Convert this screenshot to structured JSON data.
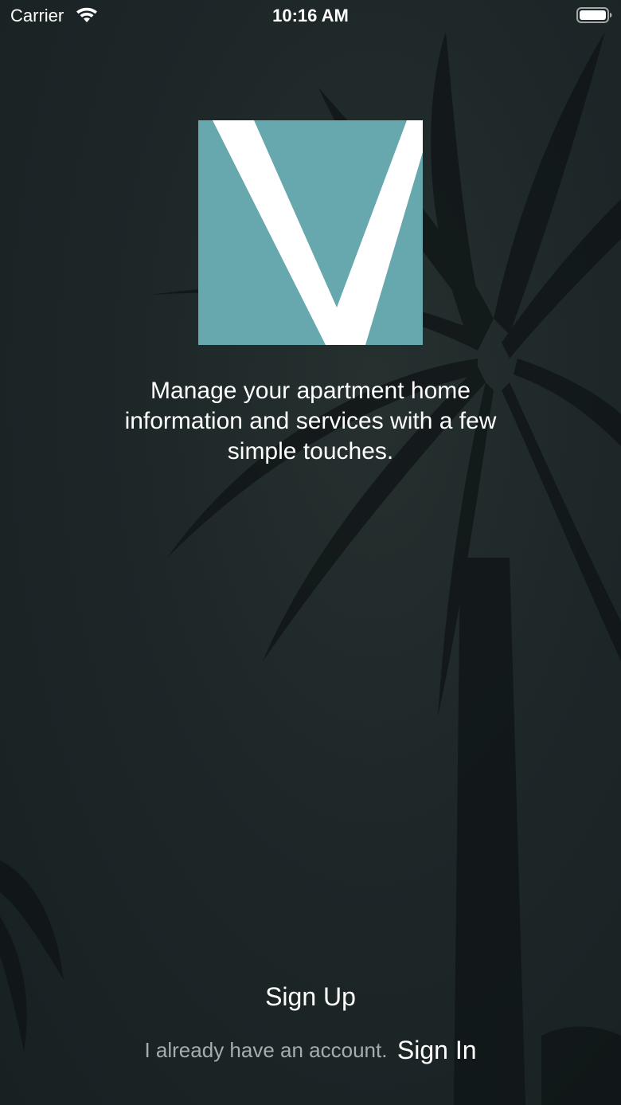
{
  "status_bar": {
    "carrier": "Carrier",
    "time": "10:16 AM",
    "wifi_icon": "wifi-icon",
    "battery_icon": "battery-full-icon"
  },
  "logo": {
    "icon": "v-logo-icon",
    "background_color": "#66a8ae",
    "letter_color": "#ffffff"
  },
  "tagline": "Manage your apartment home information and services with a few simple touches.",
  "actions": {
    "sign_up_label": "Sign Up",
    "have_account_text": "I already have an account.",
    "sign_in_label": "Sign In"
  },
  "colors": {
    "background": "#1c2526",
    "secondary_text": "#a7adae"
  }
}
